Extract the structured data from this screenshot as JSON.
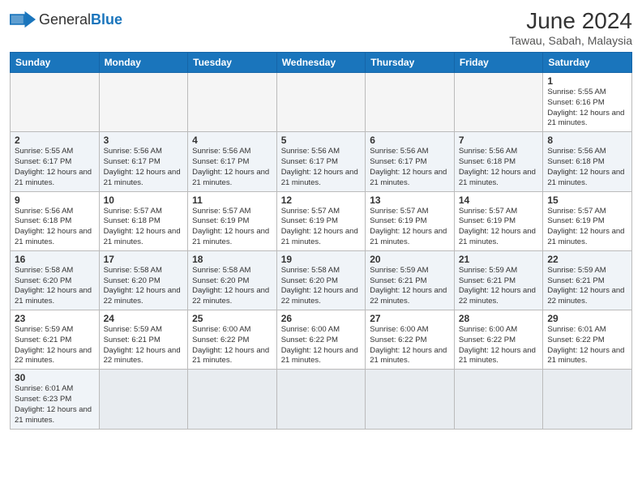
{
  "header": {
    "logo_general": "General",
    "logo_blue": "Blue",
    "title": "June 2024",
    "subtitle": "Tawau, Sabah, Malaysia"
  },
  "weekdays": [
    "Sunday",
    "Monday",
    "Tuesday",
    "Wednesday",
    "Thursday",
    "Friday",
    "Saturday"
  ],
  "weeks": [
    {
      "shaded": false,
      "days": [
        {
          "num": "",
          "info": ""
        },
        {
          "num": "",
          "info": ""
        },
        {
          "num": "",
          "info": ""
        },
        {
          "num": "",
          "info": ""
        },
        {
          "num": "",
          "info": ""
        },
        {
          "num": "",
          "info": ""
        },
        {
          "num": "1",
          "info": "Sunrise: 5:55 AM\nSunset: 6:16 PM\nDaylight: 12 hours\nand 21 minutes."
        }
      ]
    },
    {
      "shaded": true,
      "days": [
        {
          "num": "2",
          "info": "Sunrise: 5:55 AM\nSunset: 6:17 PM\nDaylight: 12 hours\nand 21 minutes."
        },
        {
          "num": "3",
          "info": "Sunrise: 5:56 AM\nSunset: 6:17 PM\nDaylight: 12 hours\nand 21 minutes."
        },
        {
          "num": "4",
          "info": "Sunrise: 5:56 AM\nSunset: 6:17 PM\nDaylight: 12 hours\nand 21 minutes."
        },
        {
          "num": "5",
          "info": "Sunrise: 5:56 AM\nSunset: 6:17 PM\nDaylight: 12 hours\nand 21 minutes."
        },
        {
          "num": "6",
          "info": "Sunrise: 5:56 AM\nSunset: 6:17 PM\nDaylight: 12 hours\nand 21 minutes."
        },
        {
          "num": "7",
          "info": "Sunrise: 5:56 AM\nSunset: 6:18 PM\nDaylight: 12 hours\nand 21 minutes."
        },
        {
          "num": "8",
          "info": "Sunrise: 5:56 AM\nSunset: 6:18 PM\nDaylight: 12 hours\nand 21 minutes."
        }
      ]
    },
    {
      "shaded": false,
      "days": [
        {
          "num": "9",
          "info": "Sunrise: 5:56 AM\nSunset: 6:18 PM\nDaylight: 12 hours\nand 21 minutes."
        },
        {
          "num": "10",
          "info": "Sunrise: 5:57 AM\nSunset: 6:18 PM\nDaylight: 12 hours\nand 21 minutes."
        },
        {
          "num": "11",
          "info": "Sunrise: 5:57 AM\nSunset: 6:19 PM\nDaylight: 12 hours\nand 21 minutes."
        },
        {
          "num": "12",
          "info": "Sunrise: 5:57 AM\nSunset: 6:19 PM\nDaylight: 12 hours\nand 21 minutes."
        },
        {
          "num": "13",
          "info": "Sunrise: 5:57 AM\nSunset: 6:19 PM\nDaylight: 12 hours\nand 21 minutes."
        },
        {
          "num": "14",
          "info": "Sunrise: 5:57 AM\nSunset: 6:19 PM\nDaylight: 12 hours\nand 21 minutes."
        },
        {
          "num": "15",
          "info": "Sunrise: 5:57 AM\nSunset: 6:19 PM\nDaylight: 12 hours\nand 21 minutes."
        }
      ]
    },
    {
      "shaded": true,
      "days": [
        {
          "num": "16",
          "info": "Sunrise: 5:58 AM\nSunset: 6:20 PM\nDaylight: 12 hours\nand 21 minutes."
        },
        {
          "num": "17",
          "info": "Sunrise: 5:58 AM\nSunset: 6:20 PM\nDaylight: 12 hours\nand 22 minutes."
        },
        {
          "num": "18",
          "info": "Sunrise: 5:58 AM\nSunset: 6:20 PM\nDaylight: 12 hours\nand 22 minutes."
        },
        {
          "num": "19",
          "info": "Sunrise: 5:58 AM\nSunset: 6:20 PM\nDaylight: 12 hours\nand 22 minutes."
        },
        {
          "num": "20",
          "info": "Sunrise: 5:59 AM\nSunset: 6:21 PM\nDaylight: 12 hours\nand 22 minutes."
        },
        {
          "num": "21",
          "info": "Sunrise: 5:59 AM\nSunset: 6:21 PM\nDaylight: 12 hours\nand 22 minutes."
        },
        {
          "num": "22",
          "info": "Sunrise: 5:59 AM\nSunset: 6:21 PM\nDaylight: 12 hours\nand 22 minutes."
        }
      ]
    },
    {
      "shaded": false,
      "days": [
        {
          "num": "23",
          "info": "Sunrise: 5:59 AM\nSunset: 6:21 PM\nDaylight: 12 hours\nand 22 minutes."
        },
        {
          "num": "24",
          "info": "Sunrise: 5:59 AM\nSunset: 6:21 PM\nDaylight: 12 hours\nand 22 minutes."
        },
        {
          "num": "25",
          "info": "Sunrise: 6:00 AM\nSunset: 6:22 PM\nDaylight: 12 hours\nand 21 minutes."
        },
        {
          "num": "26",
          "info": "Sunrise: 6:00 AM\nSunset: 6:22 PM\nDaylight: 12 hours\nand 21 minutes."
        },
        {
          "num": "27",
          "info": "Sunrise: 6:00 AM\nSunset: 6:22 PM\nDaylight: 12 hours\nand 21 minutes."
        },
        {
          "num": "28",
          "info": "Sunrise: 6:00 AM\nSunset: 6:22 PM\nDaylight: 12 hours\nand 21 minutes."
        },
        {
          "num": "29",
          "info": "Sunrise: 6:01 AM\nSunset: 6:22 PM\nDaylight: 12 hours\nand 21 minutes."
        }
      ]
    },
    {
      "shaded": true,
      "days": [
        {
          "num": "30",
          "info": "Sunrise: 6:01 AM\nSunset: 6:23 PM\nDaylight: 12 hours\nand 21 minutes."
        },
        {
          "num": "",
          "info": ""
        },
        {
          "num": "",
          "info": ""
        },
        {
          "num": "",
          "info": ""
        },
        {
          "num": "",
          "info": ""
        },
        {
          "num": "",
          "info": ""
        },
        {
          "num": "",
          "info": ""
        }
      ]
    }
  ]
}
